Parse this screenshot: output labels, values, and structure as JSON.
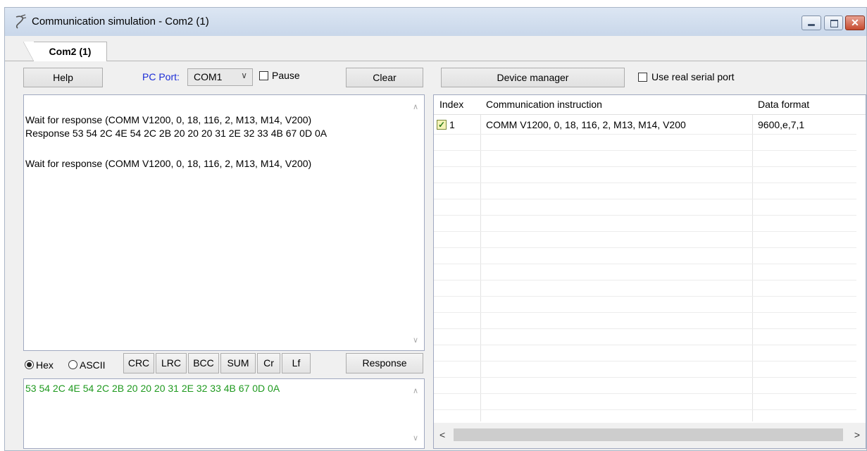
{
  "window": {
    "title": "Communication simulation - Com2 (1)"
  },
  "tabs": [
    {
      "label": "Com2 (1)"
    }
  ],
  "toolbar": {
    "help_label": "Help",
    "pc_port_label": "PC Port:",
    "pc_port_value": "COM1",
    "pause_label": "Pause",
    "pause_checked": false,
    "clear_label": "Clear",
    "device_manager_label": "Device manager",
    "use_real_serial_label": "Use real serial port",
    "use_real_serial_checked": false
  },
  "log": {
    "lines": [
      "Wait for response (COMM  V1200, 0, 18, 116, 2, M13, M14, V200)",
      "Response 53 54 2C 4E 54 2C 2B 20 20 20 31 2E 32 33 4B 67 0D 0A",
      "Wait for response (COMM  V1200, 0, 18, 116, 2, M13, M14, V200)"
    ]
  },
  "format": {
    "hex_label": "Hex",
    "ascii_label": "ASCII",
    "selected": "Hex",
    "buttons": [
      "CRC",
      "LRC",
      "BCC",
      "SUM",
      "Cr",
      "Lf"
    ],
    "response_label": "Response"
  },
  "send": {
    "value": "53 54 2C 4E 54 2C 2B 20 20 20 31 2E 32 33 4B 67 0D 0A"
  },
  "grid": {
    "headers": [
      "Index",
      "Communication instruction",
      "Data format"
    ],
    "rows": [
      {
        "checked": true,
        "index": "1",
        "instruction": "COMM  V1200, 0, 18, 116, 2, M13, M14, V200",
        "format": "9600,e,7,1"
      }
    ]
  },
  "colors": {
    "response_text": "#1f9a1f",
    "pc_port_label": "#1a2bd6"
  }
}
